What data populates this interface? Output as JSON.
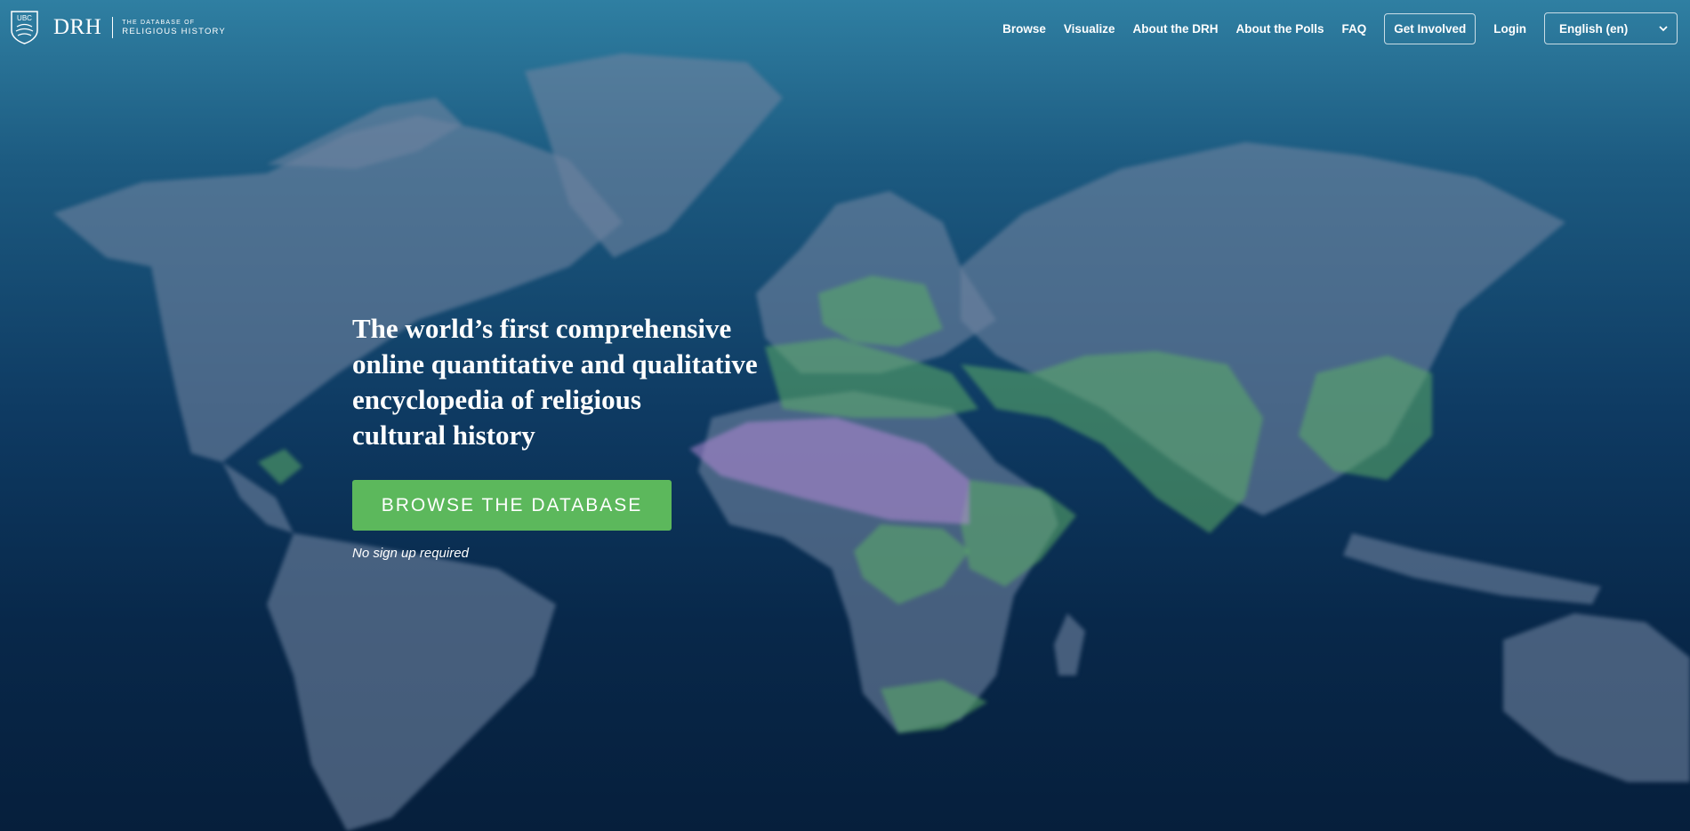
{
  "header": {
    "logo": {
      "crest_text": "UBC",
      "mark": "DRH",
      "subtitle_top": "THE DATABASE OF",
      "subtitle_bottom": "RELIGIOUS HISTORY"
    },
    "nav": {
      "items": [
        "Browse",
        "Visualize",
        "About the DRH",
        "About the Polls",
        "FAQ"
      ],
      "get_involved": "Get Involved",
      "login": "Login",
      "language": "English (en)"
    }
  },
  "hero": {
    "title_lines": [
      "The world’s first comprehensive",
      "online quantitative and qualitative",
      "encyclopedia of religious",
      "cultural history"
    ],
    "cta_label": "BROWSE THE DATABASE",
    "note": "No sign up required"
  },
  "colors": {
    "bg_top": "#2f7fa2",
    "bg_bottom": "#061f3c",
    "cta": "#5cb85c",
    "map_region_green": "#5cae68",
    "map_region_purple": "#b48ad6"
  }
}
